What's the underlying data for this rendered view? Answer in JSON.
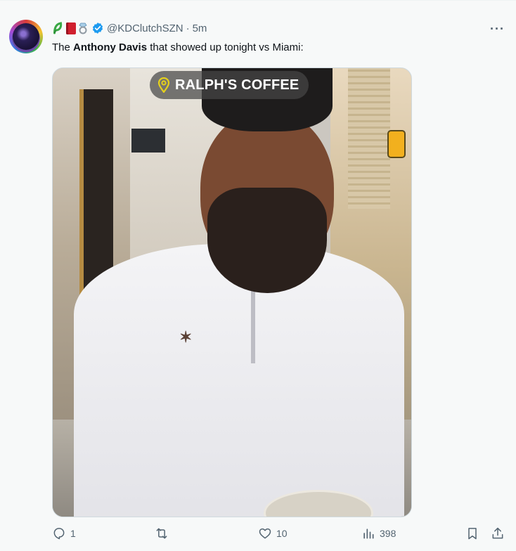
{
  "tweet": {
    "avatar_icon": "avatar-image",
    "emojis": [
      "plant-emoji",
      "book-emoji",
      "ring-emoji"
    ],
    "verified_icon": "verified-badge-icon",
    "handle": "@KDClutchSZN",
    "separator": "·",
    "time": "5m",
    "text_before": "The ",
    "text_bold": "Anthony Davis",
    "text_after": " that showed up tonight vs Miami:",
    "more_icon": "more-options-icon",
    "more_label": "···",
    "media": {
      "location_icon": "location-pin-icon",
      "location_label": "RALPH'S COFFEE",
      "logo_mark": "✶"
    },
    "actions": {
      "reply_count": "1",
      "retweet_count": "",
      "like_count": "10",
      "views_count": "398"
    },
    "colors": {
      "background": "#f7f9f9",
      "secondary_text": "#536471",
      "verified": "#1d9bf0",
      "location_pin": "#e6d11b"
    }
  }
}
